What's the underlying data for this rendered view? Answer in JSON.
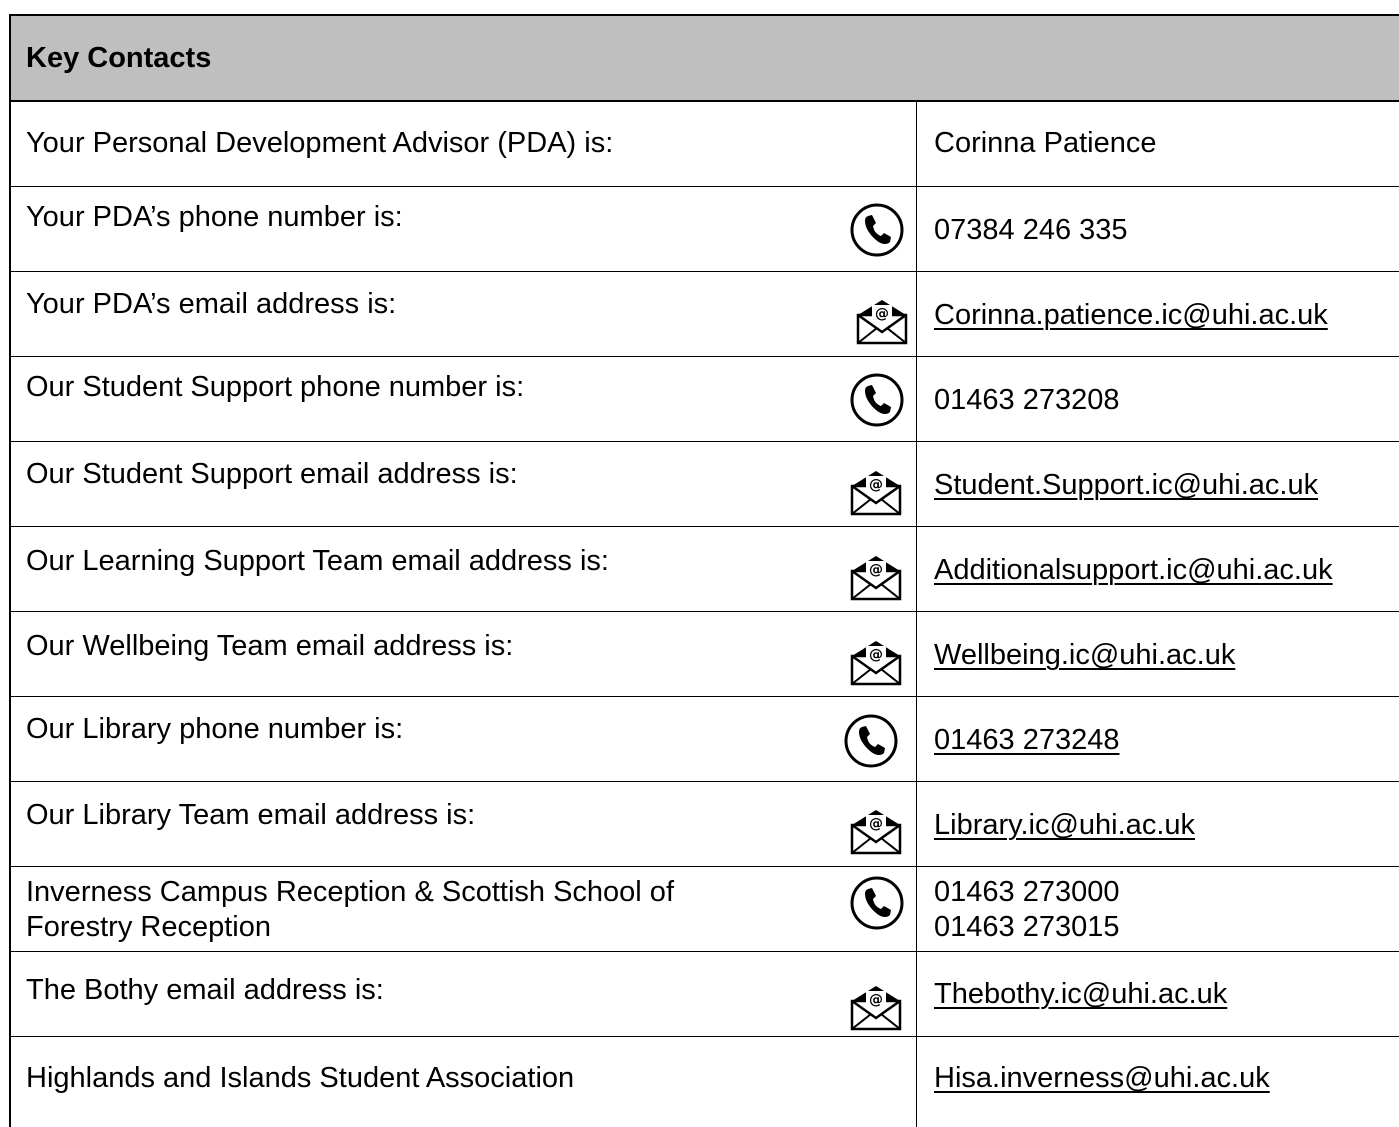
{
  "title": "Key Contacts",
  "rows": [
    {
      "label": "Your Personal Development Advisor (PDA) is:",
      "value": "Corinna Patience",
      "icon": ""
    },
    {
      "label": "Your PDA’s phone number is:",
      "value": "07384 246 335",
      "icon": "phone-icon"
    },
    {
      "label": "Your PDA’s email address is:",
      "value": "Corinna.patience.ic@uhi.ac.uk",
      "icon": "email-icon"
    },
    {
      "label": "Our Student Support phone number is:",
      "value": "01463 273208",
      "icon": "phone-icon"
    },
    {
      "label": "Our Student Support email address is:",
      "value": "Student.Support.ic@uhi.ac.uk",
      "icon": "email-icon"
    },
    {
      "label": "Our Learning Support Team email address is:",
      "value": "Additionalsupport.ic@uhi.ac.uk",
      "icon": "email-icon"
    },
    {
      "label": "Our Wellbeing Team email address is:",
      "value": "Wellbeing.ic@uhi.ac.uk",
      "icon": "email-icon"
    },
    {
      "label": "Our Library phone number is:",
      "value": "01463 273248",
      "icon": "phone-icon"
    },
    {
      "label": "Our Library Team email address is:",
      "value": "Library.ic@uhi.ac.uk",
      "icon": "email-icon"
    },
    {
      "label_line1": "Inverness Campus Reception &  Scottish School of",
      "label_line2": "Forestry Reception",
      "value_line1": "01463 273000",
      "value_line2": "01463 273015",
      "icon": "phone-icon"
    },
    {
      "label": "The Bothy email address is:",
      "value": "Thebothy.ic@uhi.ac.uk",
      "icon": "email-icon"
    },
    {
      "label": "Highlands and Islands Student Association",
      "value": "Hisa.inverness@uhi.ac.uk",
      "icon": ""
    }
  ]
}
